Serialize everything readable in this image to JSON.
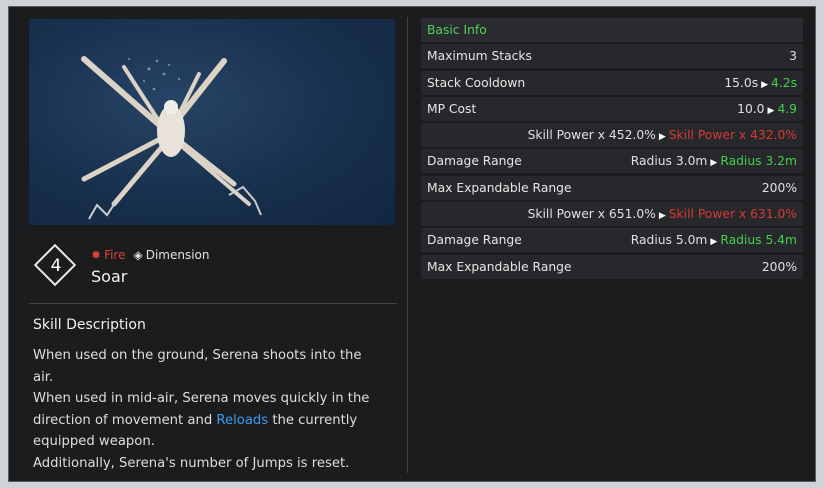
{
  "skill": {
    "level": "4",
    "name": "Soar",
    "attributes": [
      {
        "label": "Fire",
        "icon": "fire-icon",
        "color": "#e0413a"
      },
      {
        "label": "Dimension",
        "icon": "dimension-icon",
        "color": "#e2e2e2"
      }
    ]
  },
  "description": {
    "title": "Skill Description",
    "line1": "When used on the ground, Serena shoots into the air.",
    "line2_before": "When used in mid-air, Serena moves quickly in the direction of movement and ",
    "line2_link": "Reloads",
    "line2_after": " the currently equipped weapon.",
    "line3": "Additionally, Serena's number of Jumps is reset."
  },
  "stats": {
    "header": "Basic Info",
    "rows": [
      {
        "label": "Maximum Stacks",
        "old": "3",
        "new": ""
      },
      {
        "label": "Stack Cooldown",
        "old": "15.0s",
        "new": "4.2s",
        "new_color": "green"
      },
      {
        "label": "MP Cost",
        "old": "10.0",
        "new": "4.9",
        "new_color": "green"
      },
      {
        "label": "",
        "old": "Skill Power x 452.0%",
        "new": "Skill Power x 432.0%",
        "new_color": "red"
      },
      {
        "label": "Damage Range",
        "old": "Radius 3.0m",
        "new": "Radius 3.2m",
        "new_color": "green"
      },
      {
        "label": "Max Expandable Range",
        "old": "200%",
        "new": ""
      },
      {
        "label": "",
        "old": "Skill Power x 651.0%",
        "new": "Skill Power x 631.0%",
        "new_color": "red"
      },
      {
        "label": "Damage Range",
        "old": "Radius 5.0m",
        "new": "Radius 5.4m",
        "new_color": "green"
      },
      {
        "label": "Max Expandable Range",
        "old": "200%",
        "new": ""
      }
    ]
  },
  "colors": {
    "accent_green": "#45cf4c",
    "accent_red": "#d93a33",
    "link_blue": "#3a9df0",
    "panel_bg": "#1b1c1e"
  }
}
